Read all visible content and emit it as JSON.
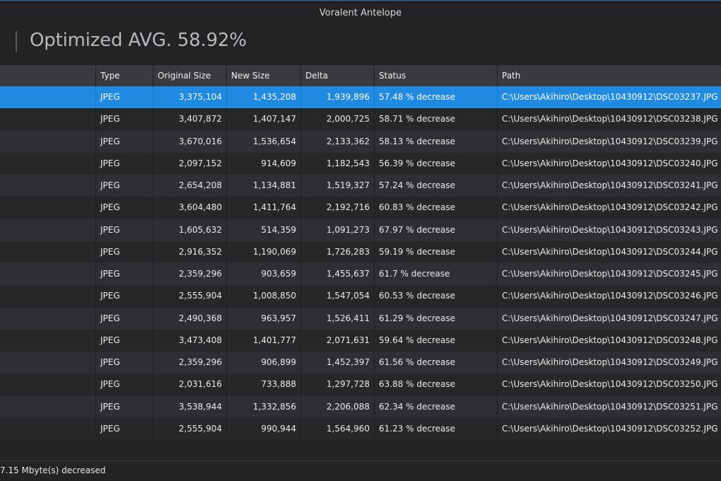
{
  "window": {
    "title": "Voralent Antelope"
  },
  "heading": {
    "text": "Optimized AVG. 58.92%"
  },
  "table": {
    "columns": [
      "",
      "Type",
      "Original Size",
      "New Size",
      "Delta",
      "Status",
      "Path"
    ],
    "selected_index": 0,
    "rows": [
      {
        "type": "JPEG",
        "original": "3,375,104",
        "new": "1,435,208",
        "delta": "1,939,896",
        "status": "57.48 % decrease",
        "path": "C:\\Users\\Akihiro\\Desktop\\10430912\\DSC03237.JPG"
      },
      {
        "type": "JPEG",
        "original": "3,407,872",
        "new": "1,407,147",
        "delta": "2,000,725",
        "status": "58.71 % decrease",
        "path": "C:\\Users\\Akihiro\\Desktop\\10430912\\DSC03238.JPG"
      },
      {
        "type": "JPEG",
        "original": "3,670,016",
        "new": "1,536,654",
        "delta": "2,133,362",
        "status": "58.13 % decrease",
        "path": "C:\\Users\\Akihiro\\Desktop\\10430912\\DSC03239.JPG"
      },
      {
        "type": "JPEG",
        "original": "2,097,152",
        "new": "914,609",
        "delta": "1,182,543",
        "status": "56.39 % decrease",
        "path": "C:\\Users\\Akihiro\\Desktop\\10430912\\DSC03240.JPG"
      },
      {
        "type": "JPEG",
        "original": "2,654,208",
        "new": "1,134,881",
        "delta": "1,519,327",
        "status": "57.24 % decrease",
        "path": "C:\\Users\\Akihiro\\Desktop\\10430912\\DSC03241.JPG"
      },
      {
        "type": "JPEG",
        "original": "3,604,480",
        "new": "1,411,764",
        "delta": "2,192,716",
        "status": "60.83 % decrease",
        "path": "C:\\Users\\Akihiro\\Desktop\\10430912\\DSC03242.JPG"
      },
      {
        "type": "JPEG",
        "original": "1,605,632",
        "new": "514,359",
        "delta": "1,091,273",
        "status": "67.97 % decrease",
        "path": "C:\\Users\\Akihiro\\Desktop\\10430912\\DSC03243.JPG"
      },
      {
        "type": "JPEG",
        "original": "2,916,352",
        "new": "1,190,069",
        "delta": "1,726,283",
        "status": "59.19 % decrease",
        "path": "C:\\Users\\Akihiro\\Desktop\\10430912\\DSC03244.JPG"
      },
      {
        "type": "JPEG",
        "original": "2,359,296",
        "new": "903,659",
        "delta": "1,455,637",
        "status": "61.7 % decrease",
        "path": "C:\\Users\\Akihiro\\Desktop\\10430912\\DSC03245.JPG"
      },
      {
        "type": "JPEG",
        "original": "2,555,904",
        "new": "1,008,850",
        "delta": "1,547,054",
        "status": "60.53 % decrease",
        "path": "C:\\Users\\Akihiro\\Desktop\\10430912\\DSC03246.JPG"
      },
      {
        "type": "JPEG",
        "original": "2,490,368",
        "new": "963,957",
        "delta": "1,526,411",
        "status": "61.29 % decrease",
        "path": "C:\\Users\\Akihiro\\Desktop\\10430912\\DSC03247.JPG"
      },
      {
        "type": "JPEG",
        "original": "3,473,408",
        "new": "1,401,777",
        "delta": "2,071,631",
        "status": "59.64 % decrease",
        "path": "C:\\Users\\Akihiro\\Desktop\\10430912\\DSC03248.JPG"
      },
      {
        "type": "JPEG",
        "original": "2,359,296",
        "new": "906,899",
        "delta": "1,452,397",
        "status": "61.56 % decrease",
        "path": "C:\\Users\\Akihiro\\Desktop\\10430912\\DSC03249.JPG"
      },
      {
        "type": "JPEG",
        "original": "2,031,616",
        "new": "733,888",
        "delta": "1,297,728",
        "status": "63.88 % decrease",
        "path": "C:\\Users\\Akihiro\\Desktop\\10430912\\DSC03250.JPG"
      },
      {
        "type": "JPEG",
        "original": "3,538,944",
        "new": "1,332,856",
        "delta": "2,206,088",
        "status": "62.34 % decrease",
        "path": "C:\\Users\\Akihiro\\Desktop\\10430912\\DSC03251.JPG"
      },
      {
        "type": "JPEG",
        "original": "2,555,904",
        "new": "990,944",
        "delta": "1,564,960",
        "status": "61.23 % decrease",
        "path": "C:\\Users\\Akihiro\\Desktop\\10430912\\DSC03252.JPG"
      }
    ]
  },
  "statusbar": {
    "text": "7.15 Mbyte(s) decreased"
  },
  "colors": {
    "background": "#232326",
    "selection": "#1f8ae0",
    "header": "#3a3a3e",
    "row_even": "#2f2f33",
    "row_odd": "#27272a",
    "heading_text": "#b9b9bd"
  }
}
